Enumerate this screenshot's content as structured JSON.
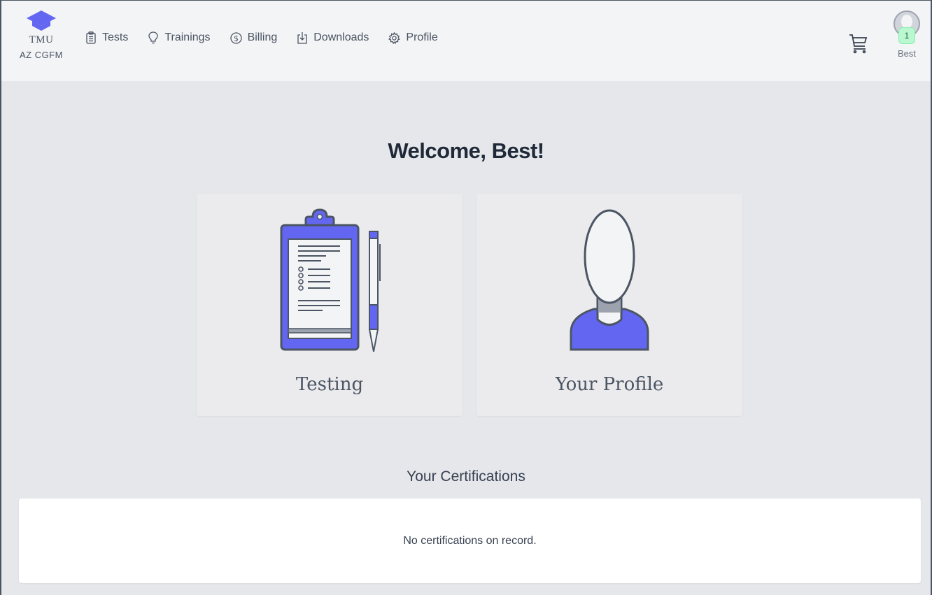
{
  "brand": {
    "name": "TMU",
    "org": "AZ CGFM",
    "logo_icon": "graduation-cap-icon",
    "color": "#6366f1"
  },
  "nav": {
    "items": [
      {
        "label": "Tests",
        "icon": "clipboard-icon"
      },
      {
        "label": "Trainings",
        "icon": "lightbulb-icon"
      },
      {
        "label": "Billing",
        "icon": "dollar-circle-icon"
      },
      {
        "label": "Downloads",
        "icon": "download-icon"
      },
      {
        "label": "Profile",
        "icon": "gear-icon"
      }
    ]
  },
  "header": {
    "cart_icon": "shopping-cart-icon",
    "user": {
      "name": "Best",
      "badge_count": "1"
    }
  },
  "main": {
    "welcome": "Welcome, Best!",
    "cards": [
      {
        "label": "Testing",
        "icon": "clipboard-pen-icon"
      },
      {
        "label": "Your Profile",
        "icon": "person-silhouette-icon"
      }
    ],
    "certifications": {
      "title": "Your Certifications",
      "empty_message": "No certifications on record."
    }
  },
  "colors": {
    "accent": "#6366f1",
    "background": "#e5e7eb",
    "topbar": "#f3f4f6",
    "badge": "#bbf7d0"
  }
}
